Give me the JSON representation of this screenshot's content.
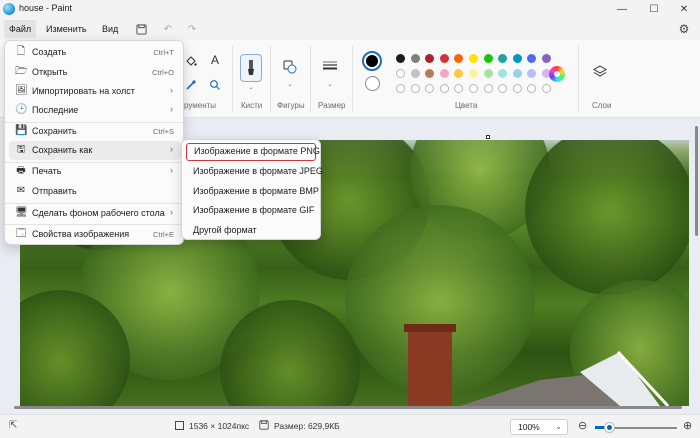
{
  "window": {
    "title": "house - Paint"
  },
  "menubar": {
    "file": "Файл",
    "edit": "Изменить",
    "view": "Вид"
  },
  "ribbon": {
    "tools_label": "рументы",
    "brushes_label": "Кисти",
    "shapes_label": "Фигуры",
    "size_label": "Размер",
    "colors_label": "Цвета",
    "layers_label": "Слои",
    "palette_row1": [
      "#1b1b1b",
      "#7f7f7f",
      "#a4262c",
      "#d13438",
      "#f7630c",
      "#fde300",
      "#16c60c",
      "#1ba5a0",
      "#0099bc",
      "#4f6bed",
      "#8764b8"
    ],
    "palette_row2": [
      "#ffffff",
      "#c3c3c3",
      "#b97a57",
      "#f4a6c4",
      "#ffc83d",
      "#fff29e",
      "#a6e3a1",
      "#9fe3e0",
      "#9ad0ec",
      "#b4c0f5",
      "#d6b4f0"
    ]
  },
  "file_menu": {
    "items": [
      {
        "icon": "new-file-icon",
        "glyph": "🗋",
        "label": "Создать",
        "shortcut": "Ctrl+T"
      },
      {
        "icon": "open-folder-icon",
        "glyph": "🗁",
        "label": "Открыть",
        "shortcut": "Ctrl+O"
      },
      {
        "icon": "import-icon",
        "glyph": "🖼",
        "label": "Импортировать на холст",
        "arrow": "›"
      },
      {
        "icon": "recent-icon",
        "glyph": "🕒",
        "label": "Последние",
        "arrow": "›"
      },
      {
        "icon": "save-icon",
        "glyph": "💾",
        "label": "Сохранить",
        "shortcut": "Ctrl+S"
      },
      {
        "icon": "save-as-icon",
        "glyph": "🖫",
        "label": "Сохранить как",
        "arrow": "›"
      },
      {
        "icon": "print-icon",
        "glyph": "🖶",
        "label": "Печать",
        "arrow": "›"
      },
      {
        "icon": "send-icon",
        "glyph": "✉",
        "label": "Отправить"
      },
      {
        "icon": "desktop-background-icon",
        "glyph": "🖥",
        "label": "Сделать фоном рабочего стола",
        "arrow": "›"
      },
      {
        "icon": "image-properties-icon",
        "glyph": "🗔",
        "label": "Свойства изображения",
        "shortcut": "Ctrl+E"
      }
    ]
  },
  "save_as_menu": {
    "items": [
      "Изображение в формате PNG",
      "Изображение в формате JPEG",
      "Изображение в формате BMP",
      "Изображение в формате GIF",
      "Другой формат"
    ]
  },
  "status": {
    "dimensions": "1536 × 1024пкс",
    "size": "Размер: 629,9КБ",
    "zoom": "100%"
  }
}
